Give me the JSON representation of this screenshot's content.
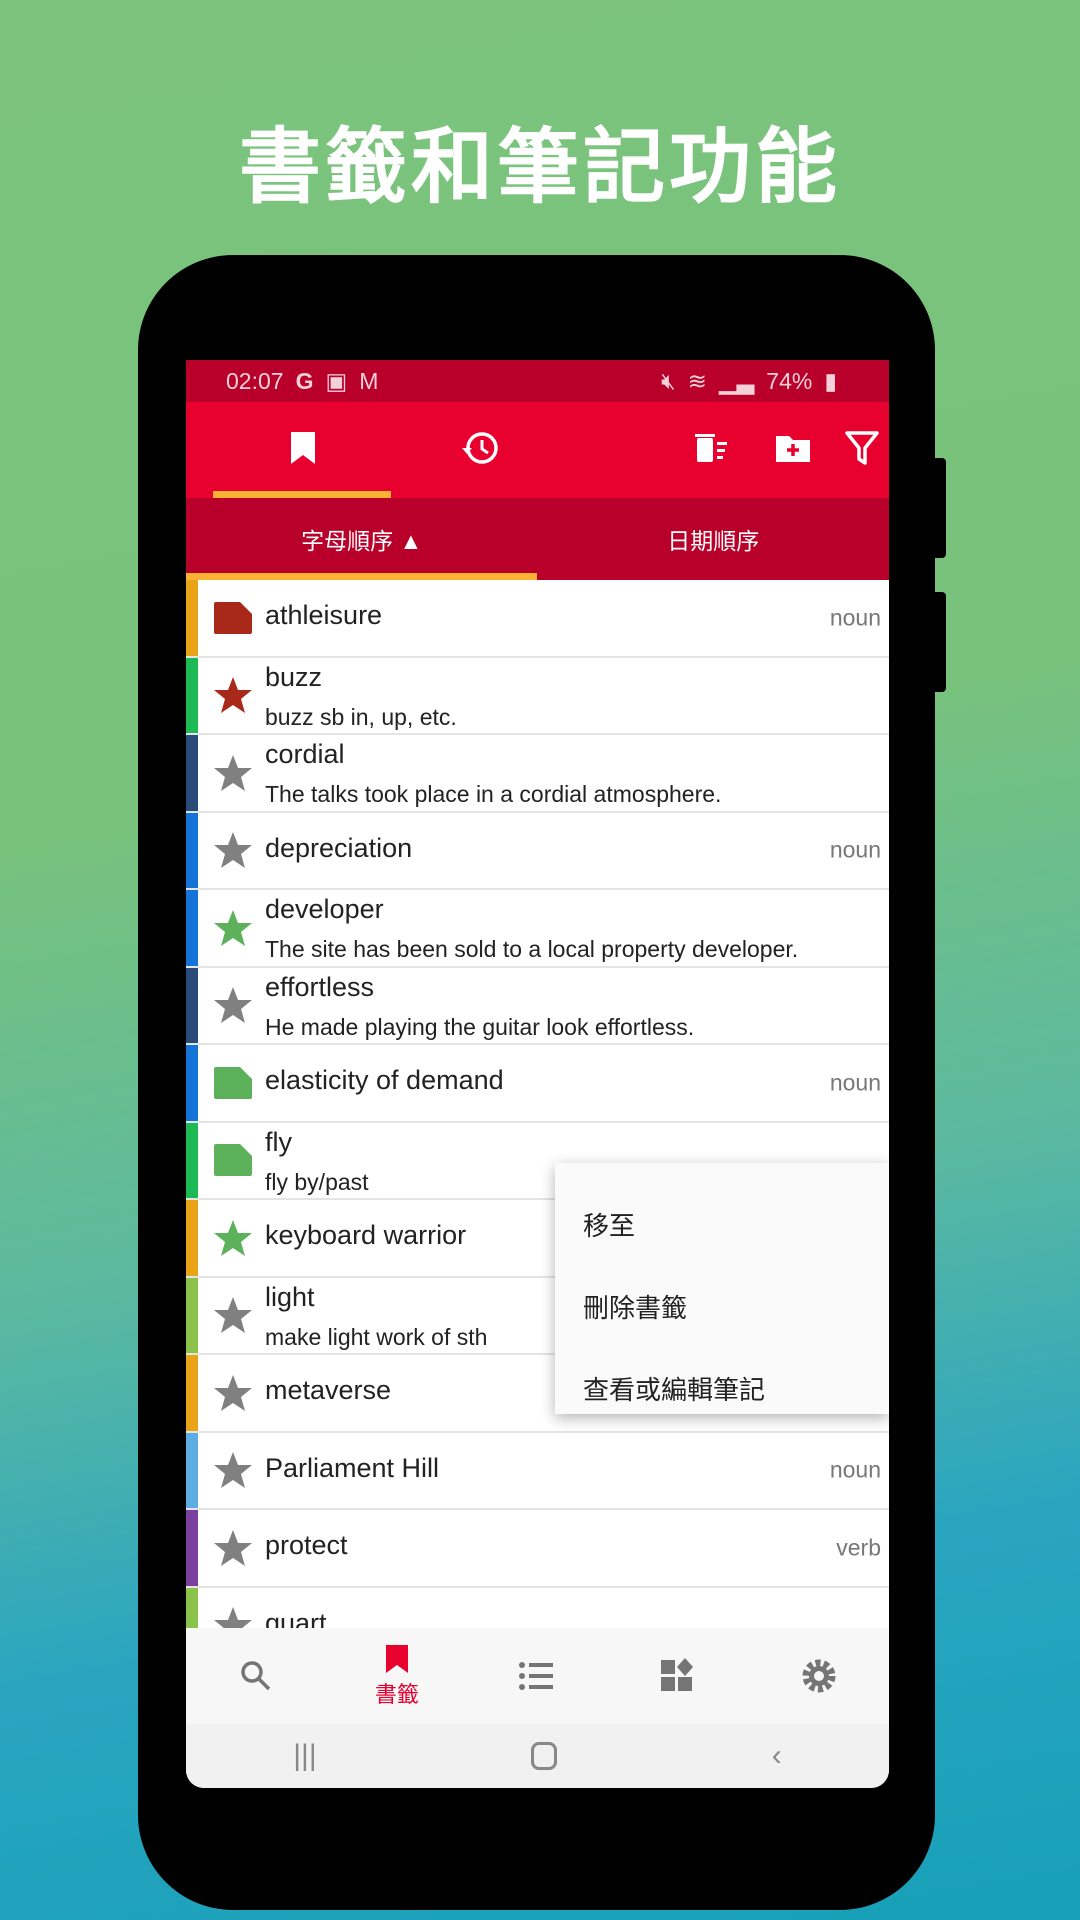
{
  "headline": "書籤和筆記功能",
  "status": {
    "time": "02:07",
    "battery": "74%"
  },
  "toolbar": {
    "tabs": [
      "bookmark",
      "history"
    ],
    "actions": [
      "delete-sort",
      "new-folder",
      "filter"
    ]
  },
  "sort_tabs": [
    {
      "label": "字母順序 ▲",
      "active": true
    },
    {
      "label": "日期順序",
      "active": false
    }
  ],
  "colors": {
    "accent": "#e8002f",
    "indicator": "#f9b233"
  },
  "rows": [
    {
      "word": "athleisure",
      "sub": "",
      "pos": "noun",
      "icon": "note",
      "icon_color": "#a8291a",
      "bar": "#e8a317"
    },
    {
      "word": "buzz",
      "sub": "buzz sb in, up, etc.",
      "pos": "",
      "icon": "star",
      "icon_color": "#a8291a",
      "bar": "#1db954"
    },
    {
      "word": "cordial",
      "sub": "The talks took place in a cordial atmosphere.",
      "pos": "",
      "icon": "star",
      "icon_color": "#808080",
      "bar": "#2a4a7a"
    },
    {
      "word": "depreciation",
      "sub": "",
      "pos": "noun",
      "icon": "star",
      "icon_color": "#808080",
      "bar": "#1473d6"
    },
    {
      "word": "developer",
      "sub": "The site has been sold to a local property developer.",
      "pos": "",
      "icon": "star",
      "icon_color": "#5cb15a",
      "bar": "#1473d6"
    },
    {
      "word": "effortless",
      "sub": "He made playing the guitar look effortless.",
      "pos": "",
      "icon": "star",
      "icon_color": "#808080",
      "bar": "#2a4a7a"
    },
    {
      "word": "elasticity of demand",
      "sub": "",
      "pos": "noun",
      "icon": "note",
      "icon_color": "#5cb15a",
      "bar": "#1473d6"
    },
    {
      "word": "fly",
      "sub": "fly by/past",
      "pos": "",
      "icon": "note",
      "icon_color": "#5cb15a",
      "bar": "#1db954"
    },
    {
      "word": "keyboard warrior",
      "sub": "",
      "pos": "",
      "icon": "star",
      "icon_color": "#5cb15a",
      "bar": "#e8a317"
    },
    {
      "word": "light",
      "sub": "make light work of sth",
      "pos": "",
      "icon": "star",
      "icon_color": "#808080",
      "bar": "#8bc34a"
    },
    {
      "word": "metaverse",
      "sub": "",
      "pos": "",
      "icon": "star",
      "icon_color": "#808080",
      "bar": "#e8a317"
    },
    {
      "word": "Parliament Hill",
      "sub": "",
      "pos": "noun",
      "icon": "star",
      "icon_color": "#808080",
      "bar": "#5dade2"
    },
    {
      "word": "protect",
      "sub": "",
      "pos": "verb",
      "icon": "star",
      "icon_color": "#808080",
      "bar": "#7b3fa0"
    },
    {
      "word": "quart",
      "sub": "",
      "pos": "",
      "icon": "star",
      "icon_color": "#808080",
      "bar": "#8bc34a"
    }
  ],
  "context_menu": [
    "移至",
    "刪除書籤",
    "查看或編輯筆記"
  ],
  "bottom_nav": {
    "active_label": "書籤",
    "items": [
      "search",
      "bookmarks",
      "list",
      "widgets",
      "settings"
    ]
  }
}
